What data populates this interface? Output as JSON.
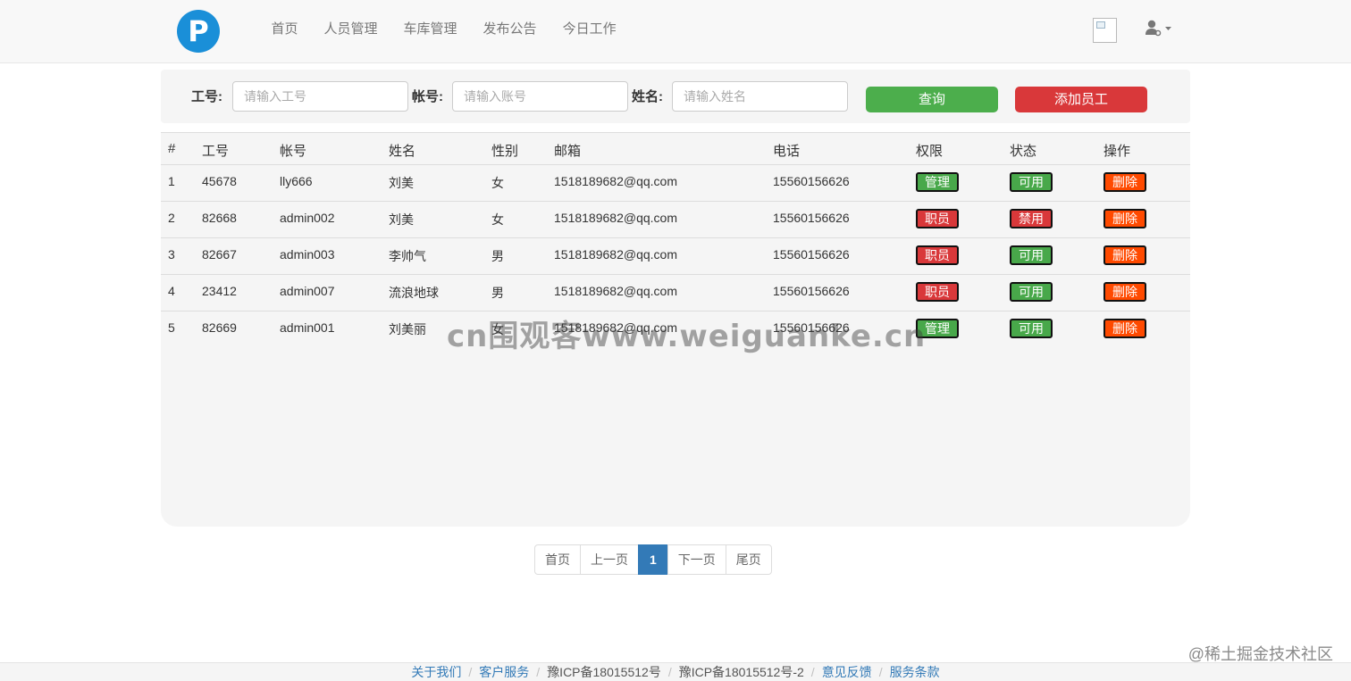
{
  "nav": {
    "logo_letter": "P",
    "items": [
      "首页",
      "人员管理",
      "车库管理",
      "发布公告",
      "今日工作"
    ]
  },
  "search": {
    "labels": {
      "job_no": "工号:",
      "account": "帐号:",
      "name": "姓名:"
    },
    "placeholders": {
      "job_no": "请输入工号",
      "account": "请输入账号",
      "name": "请输入姓名"
    },
    "query_label": "查询",
    "add_label": "添加员工"
  },
  "table": {
    "headers": [
      "#",
      "工号",
      "帐号",
      "姓名",
      "性别",
      "邮箱",
      "电话",
      "权限",
      "状态",
      "操作"
    ],
    "rows": [
      {
        "idx": "1",
        "job_no": "45678",
        "account": "lly666",
        "name": "刘美",
        "gender": "女",
        "email": "1518189682@qq.com",
        "phone": "15560156626",
        "role": "管理",
        "status": "可用",
        "op": "删除"
      },
      {
        "idx": "2",
        "job_no": "82668",
        "account": "admin002",
        "name": "刘美",
        "gender": "女",
        "email": "1518189682@qq.com",
        "phone": "15560156626",
        "role": "职员",
        "status": "禁用",
        "op": "删除"
      },
      {
        "idx": "3",
        "job_no": "82667",
        "account": "admin003",
        "name": "李帅气",
        "gender": "男",
        "email": "1518189682@qq.com",
        "phone": "15560156626",
        "role": "职员",
        "status": "可用",
        "op": "删除"
      },
      {
        "idx": "4",
        "job_no": "23412",
        "account": "admin007",
        "name": "流浪地球",
        "gender": "男",
        "email": "1518189682@qq.com",
        "phone": "15560156626",
        "role": "职员",
        "status": "可用",
        "op": "删除"
      },
      {
        "idx": "5",
        "job_no": "82669",
        "account": "admin001",
        "name": "刘美丽",
        "gender": "女",
        "email": "1518189682@qq.com",
        "phone": "15560156626",
        "role": "管理",
        "status": "可用",
        "op": "删除"
      }
    ]
  },
  "colors": {
    "primary": "#337ab7",
    "success": "#48a84a",
    "danger": "#d9383a",
    "warning": "#ff4a00",
    "logo": "#1a8fd8"
  },
  "pagination": {
    "first": "首页",
    "prev": "上一页",
    "current": "1",
    "next": "下一页",
    "last": "尾页"
  },
  "footer": {
    "links": [
      "关于我们",
      "客户服务",
      "豫ICP备18015512号",
      "豫ICP备18015512号-2",
      "意见反馈",
      "服务条款"
    ],
    "separator": "/"
  },
  "watermark": "cn围观客www.weiguanke.cn",
  "juejin_mark": "@稀土掘金技术社区"
}
